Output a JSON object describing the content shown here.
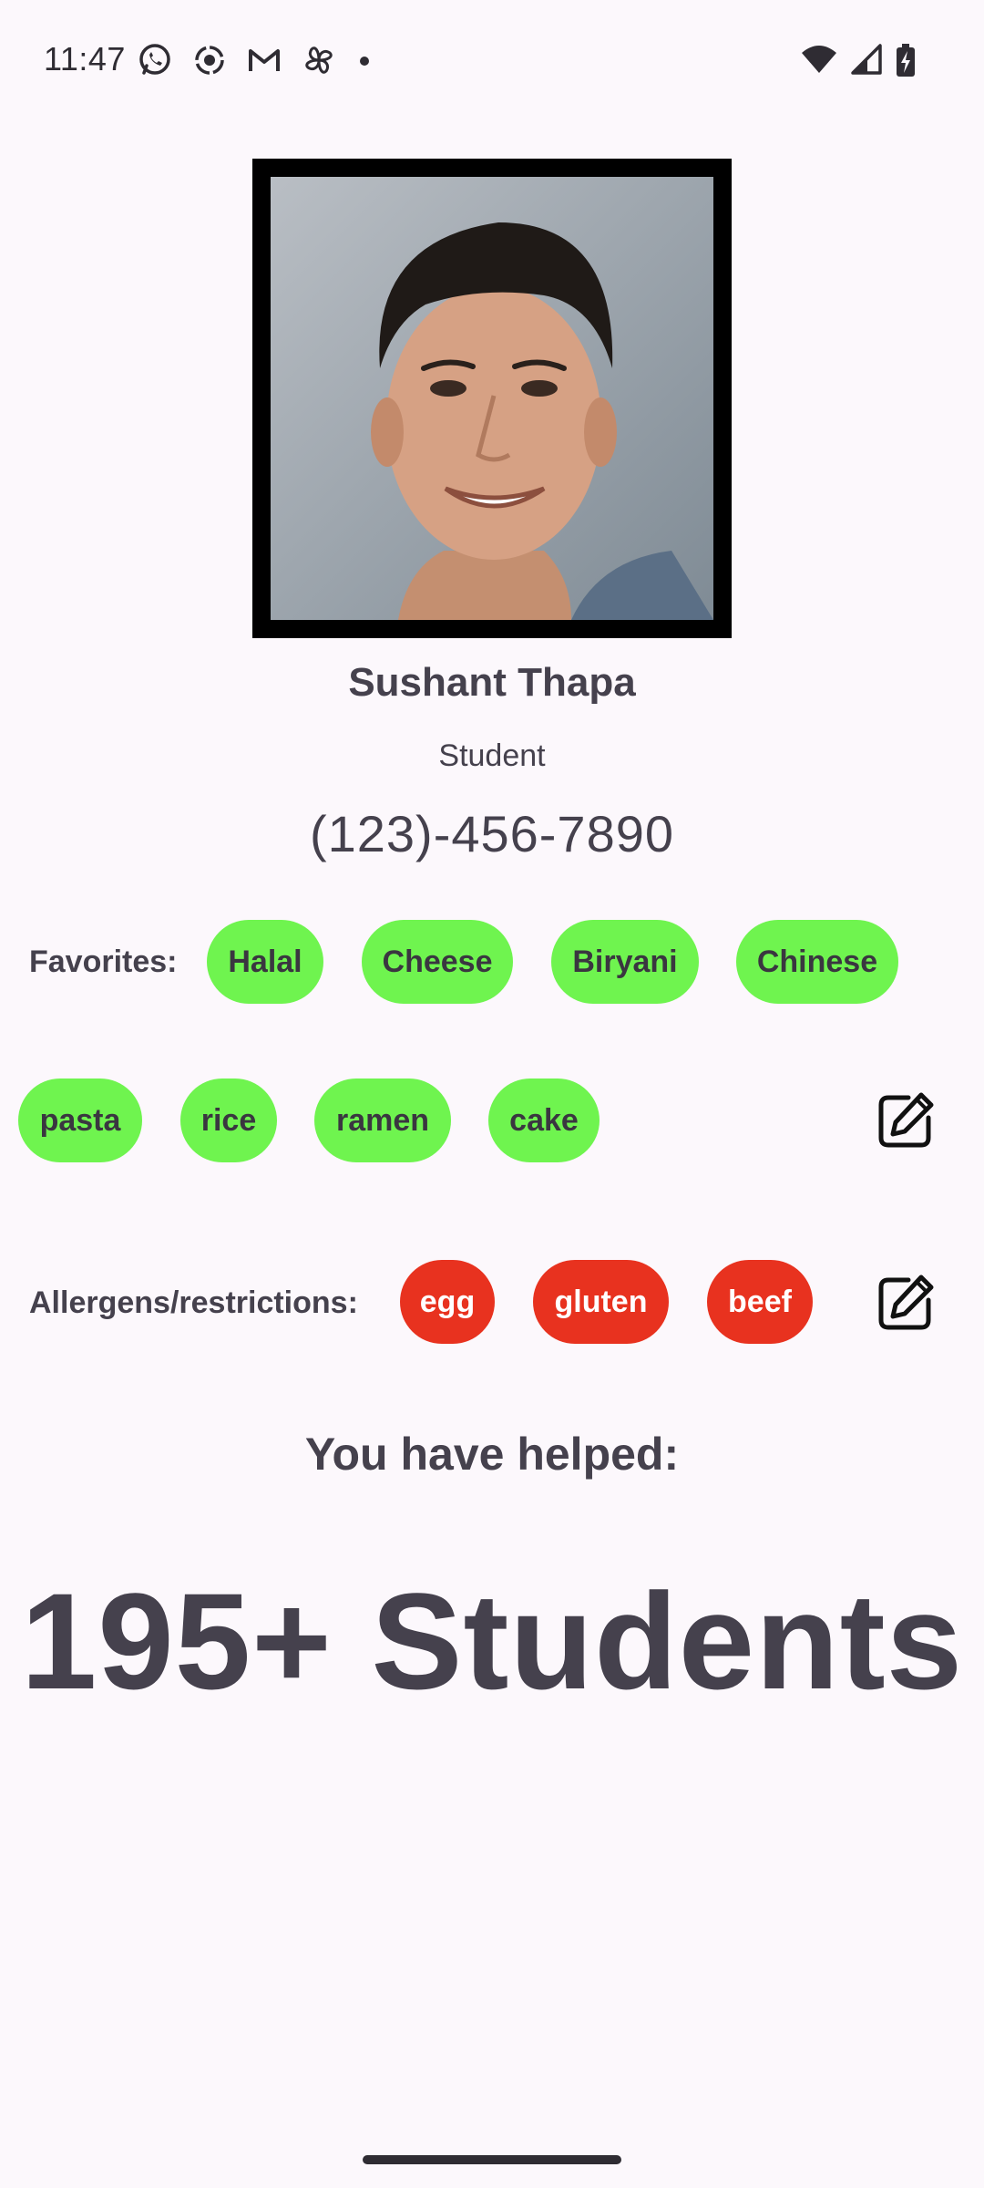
{
  "status_bar": {
    "time": "11:47",
    "left_icons": [
      "whatsapp-icon",
      "screen-record-icon",
      "gmail-icon",
      "pinwheel-icon",
      "notification-dot-icon"
    ],
    "right_icons": [
      "wifi-icon",
      "cellular-signal-icon",
      "battery-charging-icon"
    ]
  },
  "profile": {
    "photo_icon": "profile-photo",
    "name": "Sushant Thapa",
    "role": "Student",
    "phone": "(123)-456-7890"
  },
  "favorites": {
    "label": "Favorites:",
    "items": [
      "Halal",
      "Cheese",
      "Biryani",
      "Chinese",
      "pasta",
      "rice",
      "ramen",
      "cake"
    ],
    "chip_color": "#6ff44f",
    "edit_icon": "edit-icon"
  },
  "allergens": {
    "label": "Allergens/restrictions:",
    "items": [
      "egg",
      "gluten",
      "beef"
    ],
    "chip_color": "#e8321f",
    "edit_icon": "edit-icon"
  },
  "impact": {
    "title": "You have helped:",
    "count": "195+ Students"
  }
}
